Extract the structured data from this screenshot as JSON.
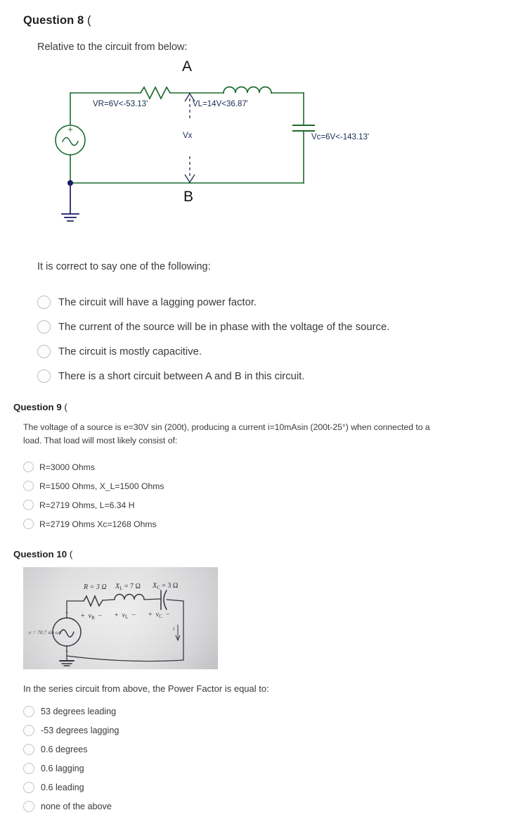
{
  "question8": {
    "header": "Question 8",
    "header_paren": "(",
    "prompt": "Relative to the circuit from below:",
    "circuit": {
      "node_top": "A",
      "node_bottom": "B",
      "label_vr": "VR=6V<-53.13'",
      "label_vl": "VL=14V<36.87'",
      "label_vc": "Vc=6V<-143.13'",
      "label_vx": "Vx",
      "source_plus": "+",
      "wire_color": "#1d6b2e",
      "label_color": "#1c2a52",
      "node_color": "#1a1a66"
    },
    "subprompt": "It is correct to say one of the following:",
    "options": [
      "The circuit will have a lagging power factor.",
      "The current of the source will be in phase with the voltage of the source.",
      "The circuit is mostly capacitive.",
      "There is a short circuit between A and B in this circuit."
    ]
  },
  "question9": {
    "header": "Question 9",
    "header_paren": "(",
    "body": "The voltage of a source is e=30V sin (200t), producing  a current i=10mAsin (200t-25°) when connected to a load. That load will most likely consist of:",
    "options": [
      "R=3000 Ohms",
      "R=1500 Ohms, X_L=1500 Ohms",
      "R=2719 Ohms, L=6.34 H",
      "R=2719 Ohms  Xc=1268 Ohms"
    ]
  },
  "question10": {
    "header": "Question 10",
    "header_paren": "(",
    "photo": {
      "label_r": "R = 3 Ω",
      "label_xl": "X",
      "label_xl_sub": "L",
      "label_xl_val": " = 7 Ω",
      "label_xc": "X",
      "label_xc_sub": "C",
      "label_xc_val": " = 3 Ω",
      "label_vr_plus": "+",
      "label_vr": "v",
      "label_vr_sub": "R",
      "label_vr_minus": "−",
      "label_vl_plus": "+",
      "label_vl": "v",
      "label_vl_sub": "L",
      "label_vl_minus": "−",
      "label_vc_plus": "+",
      "label_vc": "v",
      "label_vc_sub": "C",
      "label_vc_minus": "−",
      "label_source": "e = 70.7 sin ωt",
      "label_src_plus": "+",
      "label_src_minus": "−",
      "label_current": "i"
    },
    "prompt": "In the series circuit from above, the Power Factor is equal to:",
    "options": [
      "53 degrees leading",
      "-53 degrees lagging",
      "0.6 degrees",
      "0.6 lagging",
      "0.6 leading",
      "none of the above"
    ]
  }
}
